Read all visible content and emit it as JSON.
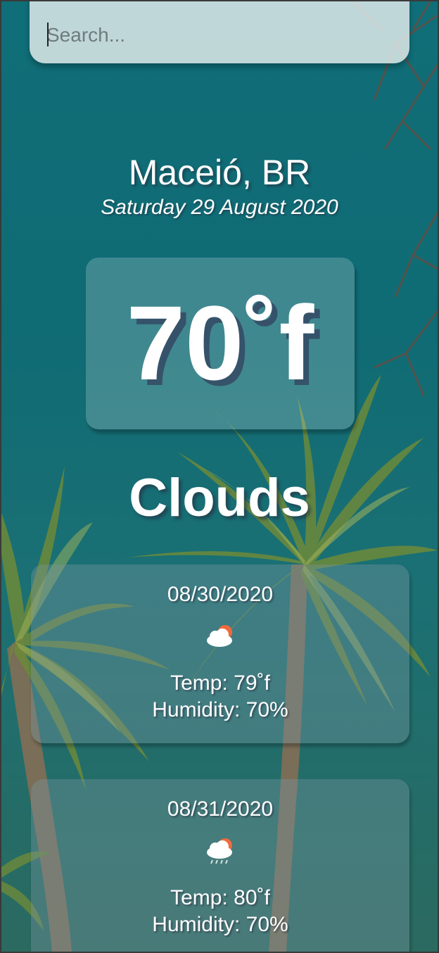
{
  "search": {
    "placeholder": "Search..."
  },
  "location": {
    "city": "Maceió, BR",
    "date": "Saturday 29 August 2020"
  },
  "current": {
    "temperature": "70˚f",
    "condition": "Clouds"
  },
  "forecast": [
    {
      "date": "08/30/2020",
      "icon": "cloud-sun-icon",
      "temp": "Temp: 79˚f",
      "humidity": "Humidity: 70%"
    },
    {
      "date": "08/31/2020",
      "icon": "cloud-sun-rain-icon",
      "temp": "Temp: 80˚f",
      "humidity": "Humidity: 70%"
    }
  ],
  "colors": {
    "background": "#106e78",
    "text": "#ffffff",
    "sun": "#f06a3d"
  }
}
